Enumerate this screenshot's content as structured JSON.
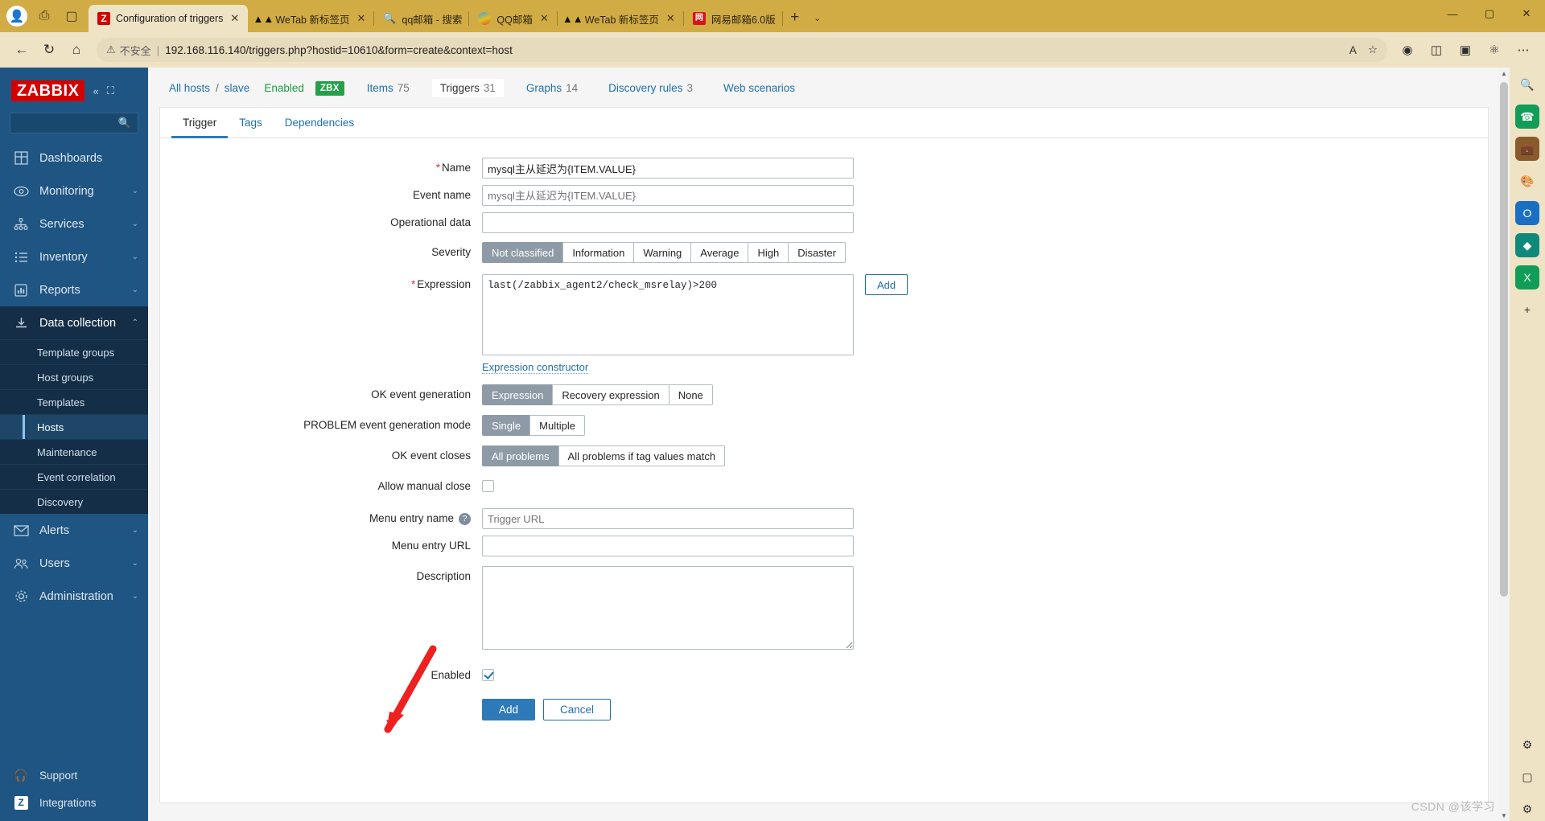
{
  "browser": {
    "tabs": [
      {
        "title": "Configuration of triggers",
        "icon": "zabbix-icon",
        "active": true,
        "closable": true
      },
      {
        "title": "WeTab 新标签页",
        "icon": "wetab-icon",
        "active": false,
        "closable": true
      },
      {
        "title": "qq邮箱 - 搜索",
        "icon": "search-icon",
        "active": false,
        "closable": false
      },
      {
        "title": "QQ邮箱",
        "icon": "qqmail-icon",
        "active": false,
        "closable": true
      },
      {
        "title": "WeTab 新标签页",
        "icon": "wetab-icon",
        "active": false,
        "closable": true
      },
      {
        "title": "网易邮箱6.0版",
        "icon": "netease-icon",
        "active": false,
        "closable": false
      }
    ],
    "new_tab_label": "+",
    "tab_list_chevron": "⌄",
    "window_controls": {
      "minimize": "—",
      "maximize": "▢",
      "close": "✕"
    },
    "nav": {
      "back": "←",
      "refresh": "↻",
      "home": "⌂",
      "security_label": "不安全",
      "warning_icon": "⚠",
      "url": "192.168.116.140/triggers.php?hostid=10610&form=create&context=host",
      "read_aloud": "A",
      "favorite": "☆",
      "right_icons": [
        "browser-essentials-icon",
        "split-screen-icon",
        "collections-icon",
        "copilot-icon",
        "settings-more-icon"
      ]
    }
  },
  "sidebar": {
    "brand": "ZABBIX",
    "collapse_icon": "«",
    "expand_icon": "⛶",
    "search_placeholder": "",
    "items": [
      {
        "label": "Dashboards",
        "icon": "dashboards-icon",
        "has_arrow": false,
        "open": false
      },
      {
        "label": "Monitoring",
        "icon": "monitoring-eye-icon",
        "has_arrow": true,
        "open": false
      },
      {
        "label": "Services",
        "icon": "services-tree-icon",
        "has_arrow": true,
        "open": false
      },
      {
        "label": "Inventory",
        "icon": "inventory-list-icon",
        "has_arrow": true,
        "open": false
      },
      {
        "label": "Reports",
        "icon": "reports-chart-icon",
        "has_arrow": true,
        "open": false
      },
      {
        "label": "Data collection",
        "icon": "data-collection-download-icon",
        "has_arrow": true,
        "open": true
      },
      {
        "label": "Alerts",
        "icon": "alerts-envelope-icon",
        "has_arrow": true,
        "open": false
      },
      {
        "label": "Users",
        "icon": "users-icon",
        "has_arrow": true,
        "open": false
      },
      {
        "label": "Administration",
        "icon": "administration-gear-icon",
        "has_arrow": true,
        "open": false
      }
    ],
    "submenu": [
      {
        "label": "Template groups",
        "active": false
      },
      {
        "label": "Host groups",
        "active": false
      },
      {
        "label": "Templates",
        "active": false
      },
      {
        "label": "Hosts",
        "active": true
      },
      {
        "label": "Maintenance",
        "active": false
      },
      {
        "label": "Event correlation",
        "active": false
      },
      {
        "label": "Discovery",
        "active": false
      }
    ],
    "footer": [
      {
        "label": "Support",
        "icon": "support-headset-icon"
      },
      {
        "label": "Integrations",
        "icon": "integrations-z-icon"
      }
    ]
  },
  "breadcrumb": {
    "all_hosts": "All hosts",
    "separator": "/",
    "host": "slave",
    "status": "Enabled",
    "agent_badge": "ZBX",
    "tabs": [
      {
        "label": "Items",
        "count": "75",
        "selected": false
      },
      {
        "label": "Triggers",
        "count": "31",
        "selected": true
      },
      {
        "label": "Graphs",
        "count": "14",
        "selected": false
      },
      {
        "label": "Discovery rules",
        "count": "3",
        "selected": false
      },
      {
        "label": "Web scenarios",
        "count": "",
        "selected": false
      }
    ]
  },
  "form": {
    "tabs": [
      {
        "label": "Trigger",
        "active": true
      },
      {
        "label": "Tags",
        "active": false
      },
      {
        "label": "Dependencies",
        "active": false
      }
    ],
    "name": {
      "label": "Name",
      "required": true,
      "value": "mysql主从延迟为{ITEM.VALUE}"
    },
    "event_name": {
      "label": "Event name",
      "required": false,
      "value": "",
      "placeholder": "mysql主从延迟为{ITEM.VALUE}"
    },
    "operational_data": {
      "label": "Operational data",
      "required": false,
      "value": "",
      "placeholder": ""
    },
    "severity": {
      "label": "Severity",
      "options": [
        "Not classified",
        "Information",
        "Warning",
        "Average",
        "High",
        "Disaster"
      ],
      "selected": "Not classified"
    },
    "expression": {
      "label": "Expression",
      "required": true,
      "value": "last(/zabbix_agent2/check_msrelay)>200",
      "add_button": "Add",
      "constructor_link": "Expression constructor"
    },
    "ok_event_generation": {
      "label": "OK event generation",
      "options": [
        "Expression",
        "Recovery expression",
        "None"
      ],
      "selected": "Expression"
    },
    "problem_event_generation_mode": {
      "label": "PROBLEM event generation mode",
      "options": [
        "Single",
        "Multiple"
      ],
      "selected": "Single"
    },
    "ok_event_closes": {
      "label": "OK event closes",
      "options": [
        "All problems",
        "All problems if tag values match"
      ],
      "selected": "All problems"
    },
    "allow_manual_close": {
      "label": "Allow manual close",
      "checked": false
    },
    "menu_entry_name": {
      "label": "Menu entry name",
      "help": "?",
      "value": "",
      "placeholder": "Trigger URL"
    },
    "menu_entry_url": {
      "label": "Menu entry URL",
      "value": "",
      "placeholder": ""
    },
    "description": {
      "label": "Description",
      "value": ""
    },
    "enabled": {
      "label": "Enabled",
      "checked": true
    },
    "submit_button": "Add",
    "cancel_button": "Cancel"
  },
  "annotation": {
    "arrow_color": "#ee2020",
    "points_to": "Add"
  },
  "watermark": "CSDN @该学习"
}
